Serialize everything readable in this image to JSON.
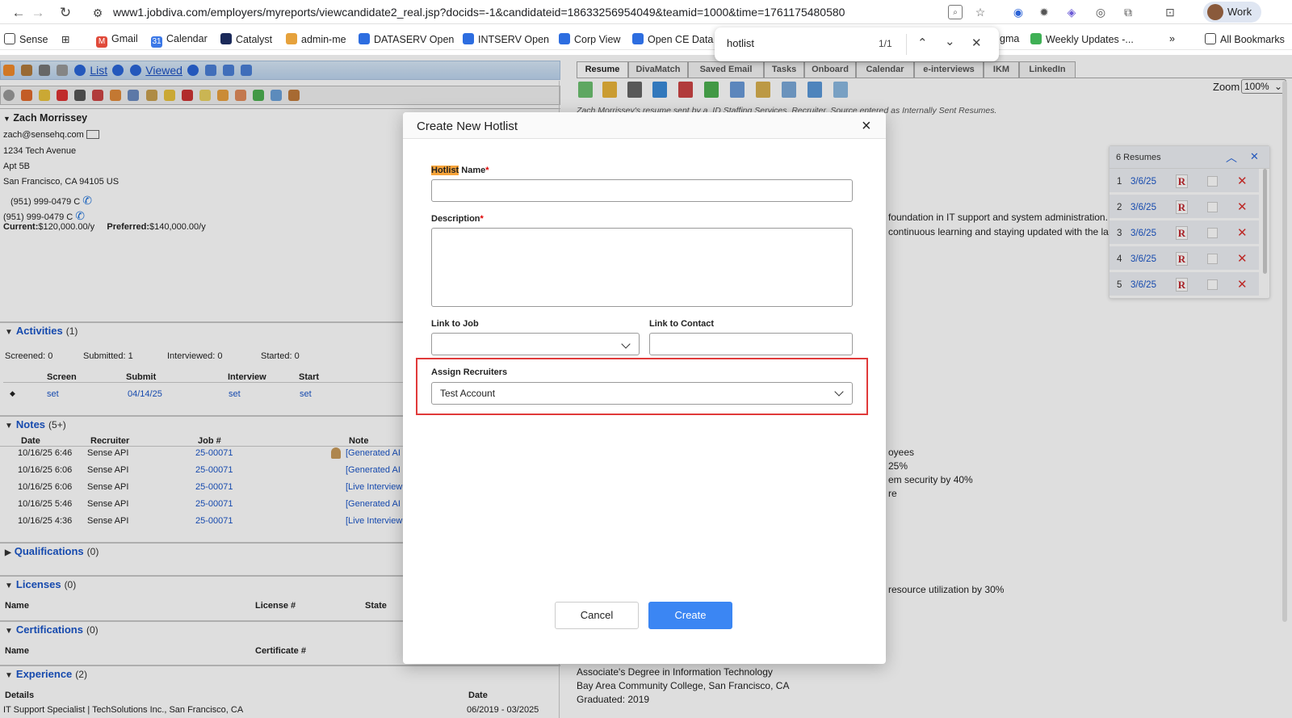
{
  "browser": {
    "url": "www1.jobdiva.com/employers/myreports/viewcandidate2_real.jsp?docids=-1&candidateid=18633256954049&teamid=1000&time=1761175480580",
    "profile_label": "Work",
    "bookmarks": [
      "Sense",
      "Gmail",
      "Calendar",
      "Catalyst",
      "admin-me",
      "DATASERV Open",
      "INTSERV Open",
      "Corp View",
      "Open CE Data",
      "gma",
      "Weekly Updates -...",
      "All Bookmarks"
    ],
    "find": {
      "query": "hotlist",
      "count": "1/1"
    }
  },
  "toolbar": {
    "list_label": "List",
    "viewed_label": "Viewed"
  },
  "candidate": {
    "name": "Zach Morrissey",
    "email": "zach@sensehq.com",
    "address1": "1234 Tech Avenue",
    "address2": "Apt 5B",
    "city_line": "San Francisco, CA 94105 US",
    "phone1": "(951) 999-0479 C",
    "phone2": "(951) 999-0479 C",
    "current_label": "Current:",
    "current_value": "$120,000.00/y",
    "preferred_label": "Preferred:",
    "preferred_value": "$140,000.00/y"
  },
  "activities": {
    "title": "Activities",
    "count": "(1)",
    "screened": "Screened: 0",
    "submitted": "Submitted: 1",
    "interviewed": "Interviewed: 0",
    "started": "Started: 0",
    "headers": [
      "Screen",
      "Submit",
      "Interview",
      "Start"
    ],
    "row": [
      "set",
      "04/14/25",
      "set",
      "set"
    ]
  },
  "notes": {
    "title": "Notes",
    "count": "(5+)",
    "headers": [
      "Date",
      "Recruiter",
      "Job #",
      "Note"
    ],
    "rows": [
      [
        "10/16/25 6:46",
        "Sense API",
        "25-00071",
        "[Generated AI S"
      ],
      [
        "10/16/25 6:06",
        "Sense API",
        "25-00071",
        "[Generated AI S"
      ],
      [
        "10/16/25 6:06",
        "Sense API",
        "25-00071",
        "[Live Interview"
      ],
      [
        "10/16/25 5:46",
        "Sense API",
        "25-00071",
        "[Generated AI S"
      ],
      [
        "10/16/25 4:36",
        "Sense API",
        "25-00071",
        "[Live Interview"
      ]
    ]
  },
  "qualifications": {
    "title": "Qualifications",
    "count": "(0)"
  },
  "licenses": {
    "title": "Licenses",
    "count": "(0)",
    "headers": [
      "Name",
      "License #",
      "State"
    ]
  },
  "certifications": {
    "title": "Certifications",
    "count": "(0)",
    "headers": [
      "Name",
      "Certificate #"
    ]
  },
  "experience": {
    "title": "Experience",
    "count": "(2)",
    "headers": [
      "Details",
      "Date"
    ],
    "row": [
      "IT Support Specialist | TechSolutions Inc., San Francisco, CA",
      "06/2019 - 03/2025"
    ]
  },
  "right": {
    "tabs": [
      "Resume",
      "DivaMatch",
      "Saved Email",
      "Tasks",
      "Onboard",
      "Calendar",
      "e-interviews",
      "IKM",
      "LinkedIn"
    ],
    "zoom_label": "Zoom",
    "zoom_value": "100%",
    "source_note": "Zach Morrissey's resume sent by a .ID Staffing Services. Recruiter. Source entered as Internally Sent Resumes.",
    "resume_lines": [
      "foundation in IT support and system administration. Sk",
      "continuous learning and staying updated with the lates",
      "oyees",
      "25%",
      "em security by 40%",
      "re",
      "resource utilization by 30%",
      "Associate's Degree in Information Technology",
      "Bay Area Community College, San Francisco, CA",
      "Graduated: 2019"
    ],
    "resumes_panel": {
      "title": "6 Resumes",
      "rows": [
        {
          "n": "1",
          "date": "3/6/25"
        },
        {
          "n": "2",
          "date": "3/6/25"
        },
        {
          "n": "3",
          "date": "3/6/25"
        },
        {
          "n": "4",
          "date": "3/6/25"
        },
        {
          "n": "5",
          "date": "3/6/25"
        }
      ],
      "r_badge": "R"
    }
  },
  "modal": {
    "title": "Create New Hotlist",
    "name_label_hl": "Hotlist",
    "name_label_rest": " Name",
    "name_value": "",
    "description_label": "Description",
    "description_value": "",
    "link_job_label": "Link to Job",
    "link_job_value": "",
    "link_contact_label": "Link to Contact",
    "link_contact_value": "",
    "assign_label": "Assign Recruiters",
    "assign_value": "Test Account",
    "cancel_label": "Cancel",
    "create_label": "Create",
    "required_mark": "*",
    "accent": "#3b86f3",
    "highlight_border": "#e03a3a"
  }
}
